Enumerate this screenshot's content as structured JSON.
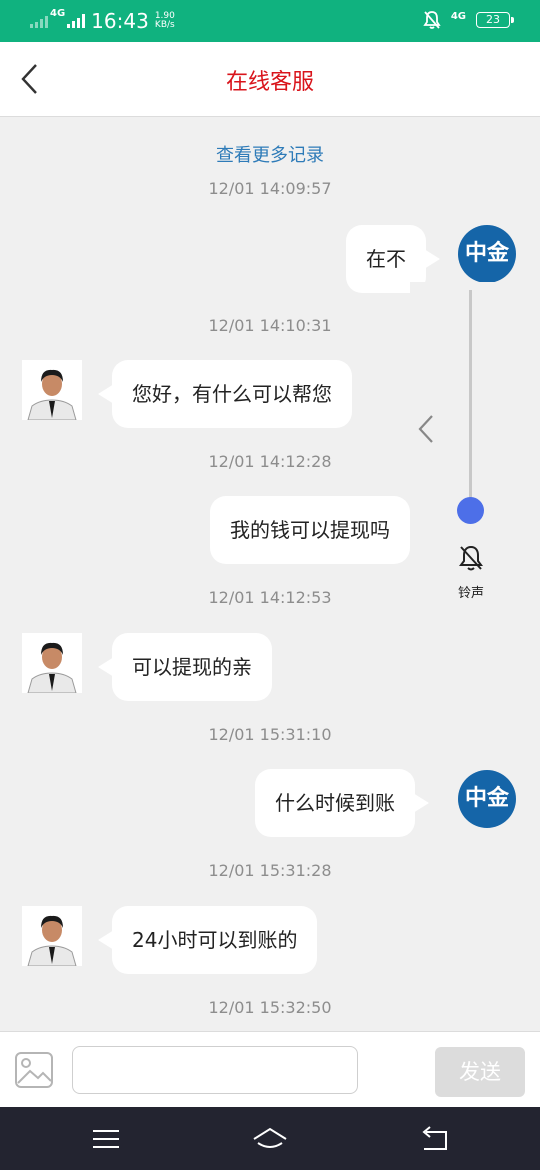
{
  "status_bar": {
    "net1": "4G",
    "net2": "4G",
    "time": "16:43",
    "speed_value": "1.90",
    "speed_unit": "KB/s",
    "battery": "23"
  },
  "header": {
    "title": "在线客服",
    "back_icon": "chevron-left-icon"
  },
  "chat": {
    "load_more": "查看更多记录",
    "user_avatar_text": "中金",
    "messages": [
      {
        "timestamp": "12/01 14:09:57",
        "sender": "user",
        "text": "在不"
      },
      {
        "timestamp": "12/01 14:10:31",
        "sender": "agent",
        "text": "您好，有什么可以帮您"
      },
      {
        "timestamp": "12/01 14:12:28",
        "sender": "user",
        "text": "我的钱可以提现吗"
      },
      {
        "timestamp": "12/01 14:12:53",
        "sender": "agent",
        "text": "可以提现的亲"
      },
      {
        "timestamp": "12/01 15:31:10",
        "sender": "user",
        "text": "什么时候到账"
      },
      {
        "timestamp": "12/01 15:31:28",
        "sender": "agent",
        "text": "24小时可以到账的"
      },
      {
        "timestamp": "12/01 15:32:50",
        "sender": null,
        "text": null
      }
    ]
  },
  "volume_panel": {
    "label": "铃声",
    "level": 0,
    "icons": [
      "chevron-left-icon",
      "bell-off-icon"
    ]
  },
  "input_bar": {
    "placeholder": "",
    "send_label": "发送",
    "image_icon": "image-icon"
  },
  "nav_bar": {
    "icons": [
      "menu-icon",
      "home-icon",
      "back-icon"
    ]
  },
  "colors": {
    "status_bar": "#10b27f",
    "title": "#d9141b",
    "link": "#2e7bb8",
    "user_avatar": "#1565a8",
    "slider_thumb": "#4d6fe8",
    "nav_bar": "#232430"
  }
}
